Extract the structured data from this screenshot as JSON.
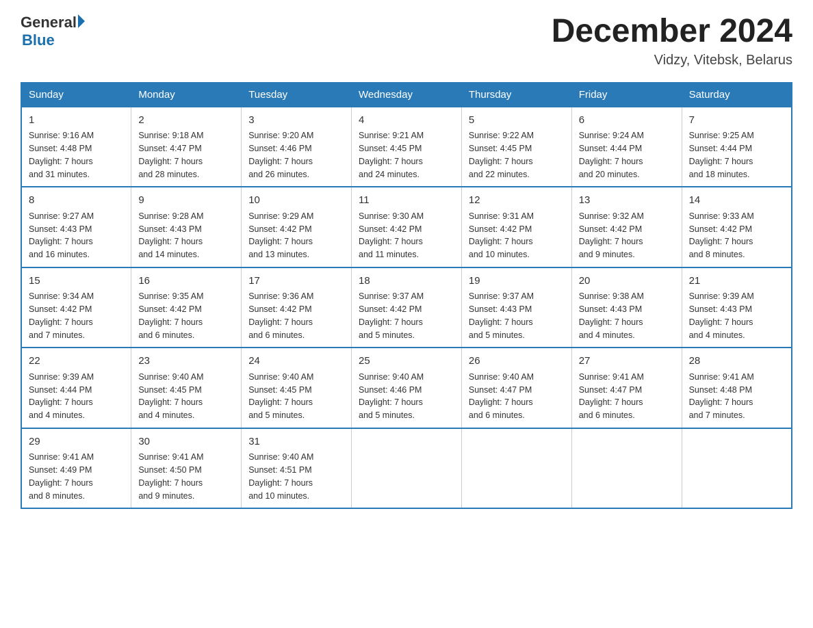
{
  "header": {
    "logo_general": "General",
    "logo_blue": "Blue",
    "month_title": "December 2024",
    "subtitle": "Vidzy, Vitebsk, Belarus"
  },
  "weekdays": [
    "Sunday",
    "Monday",
    "Tuesday",
    "Wednesday",
    "Thursday",
    "Friday",
    "Saturday"
  ],
  "weeks": [
    [
      {
        "day": "1",
        "sunrise": "9:16 AM",
        "sunset": "4:48 PM",
        "daylight": "7 hours and 31 minutes."
      },
      {
        "day": "2",
        "sunrise": "9:18 AM",
        "sunset": "4:47 PM",
        "daylight": "7 hours and 28 minutes."
      },
      {
        "day": "3",
        "sunrise": "9:20 AM",
        "sunset": "4:46 PM",
        "daylight": "7 hours and 26 minutes."
      },
      {
        "day": "4",
        "sunrise": "9:21 AM",
        "sunset": "4:45 PM",
        "daylight": "7 hours and 24 minutes."
      },
      {
        "day": "5",
        "sunrise": "9:22 AM",
        "sunset": "4:45 PM",
        "daylight": "7 hours and 22 minutes."
      },
      {
        "day": "6",
        "sunrise": "9:24 AM",
        "sunset": "4:44 PM",
        "daylight": "7 hours and 20 minutes."
      },
      {
        "day": "7",
        "sunrise": "9:25 AM",
        "sunset": "4:44 PM",
        "daylight": "7 hours and 18 minutes."
      }
    ],
    [
      {
        "day": "8",
        "sunrise": "9:27 AM",
        "sunset": "4:43 PM",
        "daylight": "7 hours and 16 minutes."
      },
      {
        "day": "9",
        "sunrise": "9:28 AM",
        "sunset": "4:43 PM",
        "daylight": "7 hours and 14 minutes."
      },
      {
        "day": "10",
        "sunrise": "9:29 AM",
        "sunset": "4:42 PM",
        "daylight": "7 hours and 13 minutes."
      },
      {
        "day": "11",
        "sunrise": "9:30 AM",
        "sunset": "4:42 PM",
        "daylight": "7 hours and 11 minutes."
      },
      {
        "day": "12",
        "sunrise": "9:31 AM",
        "sunset": "4:42 PM",
        "daylight": "7 hours and 10 minutes."
      },
      {
        "day": "13",
        "sunrise": "9:32 AM",
        "sunset": "4:42 PM",
        "daylight": "7 hours and 9 minutes."
      },
      {
        "day": "14",
        "sunrise": "9:33 AM",
        "sunset": "4:42 PM",
        "daylight": "7 hours and 8 minutes."
      }
    ],
    [
      {
        "day": "15",
        "sunrise": "9:34 AM",
        "sunset": "4:42 PM",
        "daylight": "7 hours and 7 minutes."
      },
      {
        "day": "16",
        "sunrise": "9:35 AM",
        "sunset": "4:42 PM",
        "daylight": "7 hours and 6 minutes."
      },
      {
        "day": "17",
        "sunrise": "9:36 AM",
        "sunset": "4:42 PM",
        "daylight": "7 hours and 6 minutes."
      },
      {
        "day": "18",
        "sunrise": "9:37 AM",
        "sunset": "4:42 PM",
        "daylight": "7 hours and 5 minutes."
      },
      {
        "day": "19",
        "sunrise": "9:37 AM",
        "sunset": "4:43 PM",
        "daylight": "7 hours and 5 minutes."
      },
      {
        "day": "20",
        "sunrise": "9:38 AM",
        "sunset": "4:43 PM",
        "daylight": "7 hours and 4 minutes."
      },
      {
        "day": "21",
        "sunrise": "9:39 AM",
        "sunset": "4:43 PM",
        "daylight": "7 hours and 4 minutes."
      }
    ],
    [
      {
        "day": "22",
        "sunrise": "9:39 AM",
        "sunset": "4:44 PM",
        "daylight": "7 hours and 4 minutes."
      },
      {
        "day": "23",
        "sunrise": "9:40 AM",
        "sunset": "4:45 PM",
        "daylight": "7 hours and 4 minutes."
      },
      {
        "day": "24",
        "sunrise": "9:40 AM",
        "sunset": "4:45 PM",
        "daylight": "7 hours and 5 minutes."
      },
      {
        "day": "25",
        "sunrise": "9:40 AM",
        "sunset": "4:46 PM",
        "daylight": "7 hours and 5 minutes."
      },
      {
        "day": "26",
        "sunrise": "9:40 AM",
        "sunset": "4:47 PM",
        "daylight": "7 hours and 6 minutes."
      },
      {
        "day": "27",
        "sunrise": "9:41 AM",
        "sunset": "4:47 PM",
        "daylight": "7 hours and 6 minutes."
      },
      {
        "day": "28",
        "sunrise": "9:41 AM",
        "sunset": "4:48 PM",
        "daylight": "7 hours and 7 minutes."
      }
    ],
    [
      {
        "day": "29",
        "sunrise": "9:41 AM",
        "sunset": "4:49 PM",
        "daylight": "7 hours and 8 minutes."
      },
      {
        "day": "30",
        "sunrise": "9:41 AM",
        "sunset": "4:50 PM",
        "daylight": "7 hours and 9 minutes."
      },
      {
        "day": "31",
        "sunrise": "9:40 AM",
        "sunset": "4:51 PM",
        "daylight": "7 hours and 10 minutes."
      },
      null,
      null,
      null,
      null
    ]
  ]
}
